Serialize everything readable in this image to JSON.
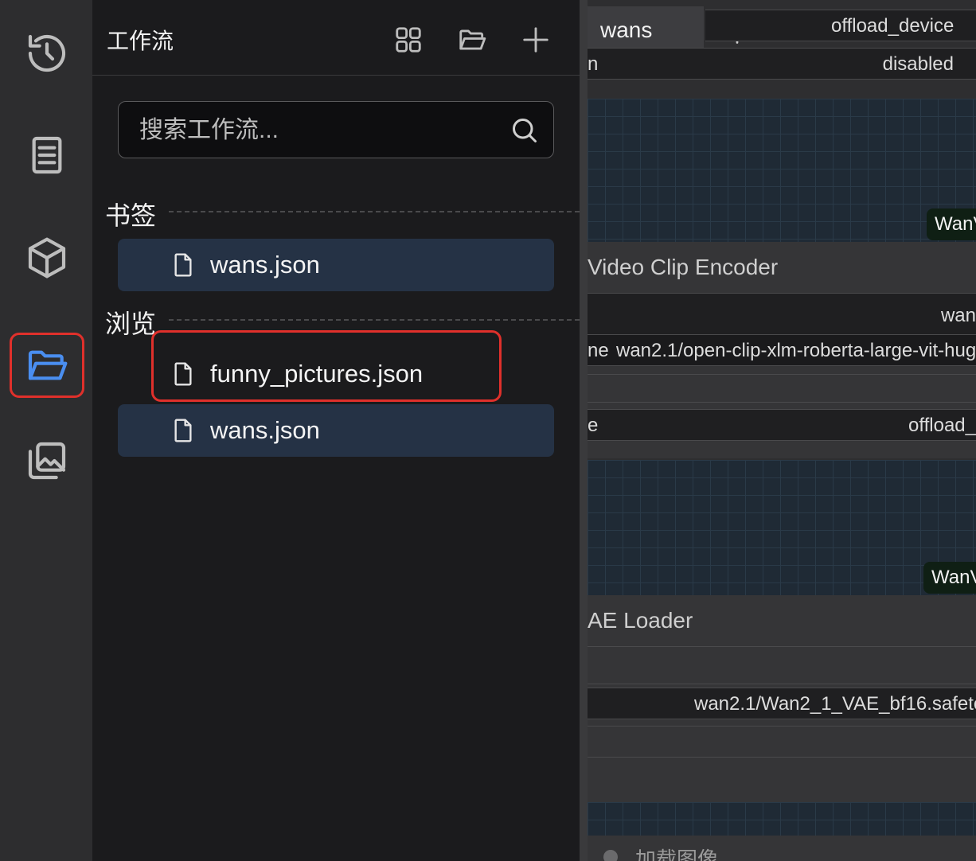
{
  "panel": {
    "title": "工作流",
    "search_placeholder": "搜索工作流...",
    "bookmarks_label": "书签",
    "browse_label": "浏览",
    "bookmarks": [
      {
        "name": "wans.json"
      }
    ],
    "browse": [
      {
        "name": "funny_pictures.json"
      },
      {
        "name": "wans.json"
      }
    ]
  },
  "canvas": {
    "tab": "wans",
    "offload_device_label": "offload_device",
    "disabled_value": "disabled",
    "chip1": "WanV",
    "clip_encoder_title": "Video Clip Encoder",
    "wan_partial": "wan",
    "clip_name_label": "ne",
    "clip_name_value": "wan2.1/open-clip-xlm-roberta-large-vit-hug",
    "load_device_label": "e",
    "offload_partial": "offload_",
    "chip2": "WanV",
    "vae_title": "AE Loader",
    "vae_value": "wan2.1/Wan2_1_VAE_bf16.safete",
    "load_image_title": "加载图像",
    "top_left_partial": "n"
  },
  "colors": {
    "accent_blue": "#4a8ef0",
    "highlight_red": "#e0302b",
    "selected_bg": "#253245"
  }
}
